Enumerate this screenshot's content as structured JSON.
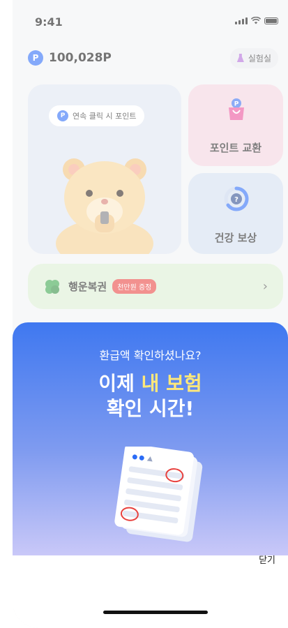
{
  "status_bar": {
    "time": "9:41"
  },
  "header": {
    "points": "100,028P",
    "point_symbol": "P",
    "lab_label": "실험실"
  },
  "cards": {
    "streak_pill": "연속 클릭 시 포인트",
    "exchange_label": "포인트 교환",
    "health_label": "건강 보상",
    "lucky_title": "행운복권",
    "lucky_badge": "천만원 증정",
    "chevron": "›"
  },
  "sheet": {
    "subtitle": "환급액 확인하셨나요?",
    "title_prefix": "이제 ",
    "title_highlight": "내 보험",
    "title_line2": "확인 시간!",
    "close_label": "닫기"
  },
  "colors": {
    "brand_blue": "#2b6cf6",
    "highlight_yellow": "#ffe87a",
    "badge_red": "#e8423f",
    "exchange_bg": "#f3d3de",
    "health_bg": "#d3deef",
    "lucky_bg": "#dbeed2"
  },
  "icons": [
    "signal-icon",
    "wifi-icon",
    "battery-icon",
    "point-icon",
    "flask-icon",
    "hamster-icon",
    "shopping-bag-icon",
    "progress-ring-icon",
    "clover-icon",
    "chevron-right-icon",
    "documents-icon"
  ]
}
